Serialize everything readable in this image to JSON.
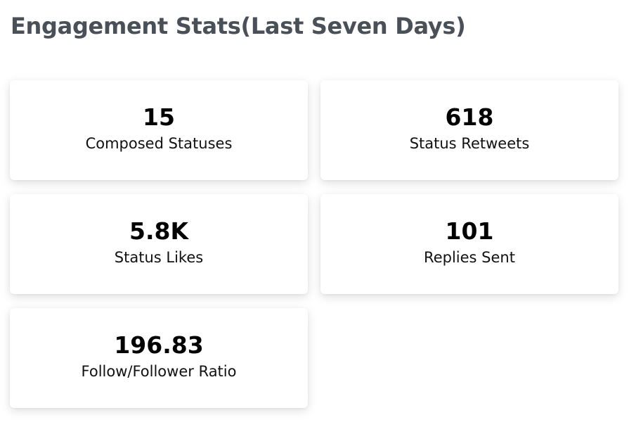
{
  "header": {
    "title": "Engagement Stats(Last Seven Days)"
  },
  "stats": [
    {
      "value": "15",
      "label": "Composed Statuses"
    },
    {
      "value": "618",
      "label": "Status Retweets"
    },
    {
      "value": "5.8K",
      "label": "Status Likes"
    },
    {
      "value": "101",
      "label": "Replies Sent"
    },
    {
      "value": "196.83",
      "label": "Follow/Follower Ratio"
    }
  ],
  "colors": {
    "title": "#4a5058",
    "value": "#000000",
    "card_background": "#ffffff"
  }
}
